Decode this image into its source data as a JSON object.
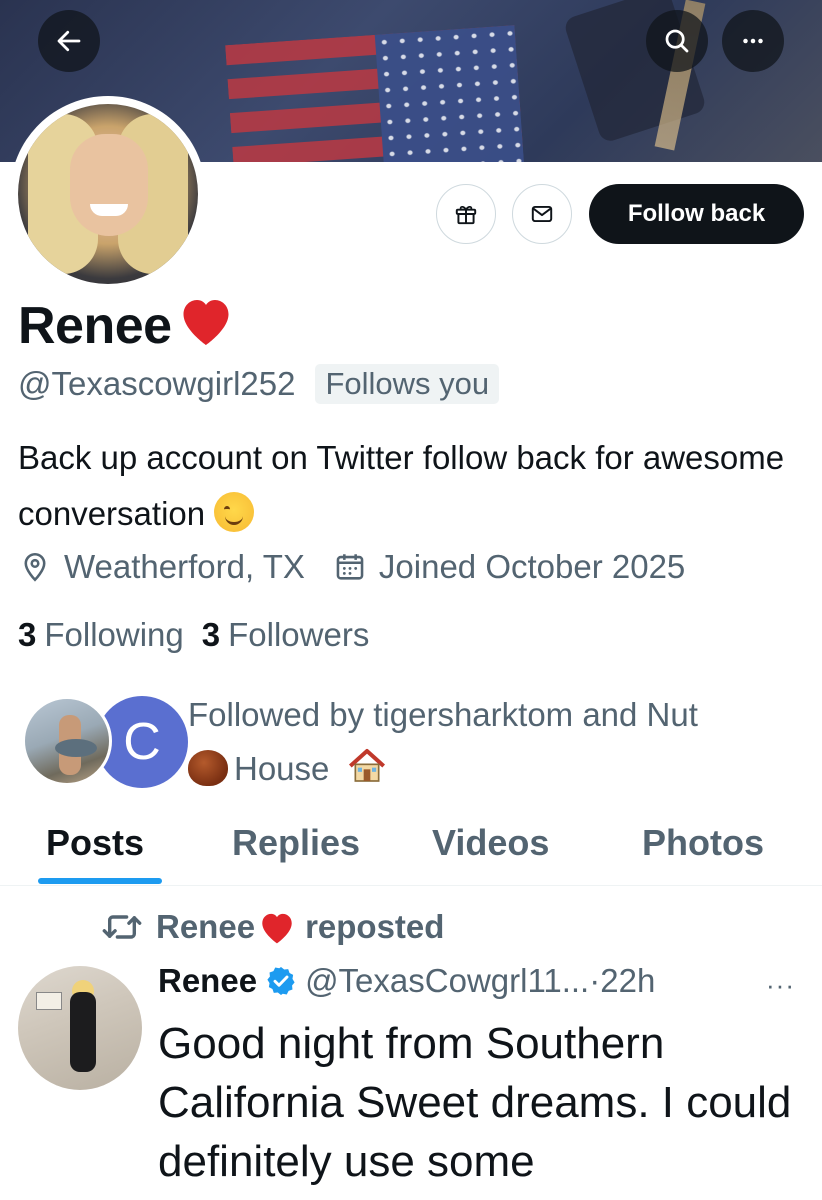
{
  "header": {
    "back_icon": "arrow-left-icon",
    "search_icon": "search-icon",
    "more_icon": "more-horizontal-icon"
  },
  "profile": {
    "name": "Renee",
    "name_emoji": "❤️",
    "handle": "@Texascowgirl252",
    "follows_you": "Follows you",
    "bio": "Back up account on Twitter follow back for awesome conversation",
    "bio_emoji": "😊",
    "location": "Weatherford, TX",
    "joined": "Joined October 2025",
    "following_count": "3",
    "following_label": "Following",
    "followers_count": "3",
    "followers_label": "Followers",
    "followed_by_text": "Followed by tigersharktom and Nut",
    "followed_by_text2": "House",
    "followed_avatar_letter": "C"
  },
  "actions": {
    "gift_icon": "gift-icon",
    "message_icon": "envelope-icon",
    "follow_label": "Follow back"
  },
  "tabs": [
    {
      "label": "Posts",
      "active": true
    },
    {
      "label": "Replies",
      "active": false
    },
    {
      "label": "Videos",
      "active": false
    },
    {
      "label": "Photos",
      "active": false
    }
  ],
  "post": {
    "repost_user": "Renee",
    "repost_label": "reposted",
    "author_name": "Renee",
    "author_handle": "@TexasCowgrl11...",
    "time": "22h",
    "more": "···",
    "text": "Good night from Southern California Sweet dreams.  I could definitely use some"
  },
  "colors": {
    "accent": "#1d9bf0",
    "text_primary": "#0f1419",
    "text_secondary": "#536471",
    "follow_button_bg": "#0f1419",
    "heart": "#e0252b"
  }
}
